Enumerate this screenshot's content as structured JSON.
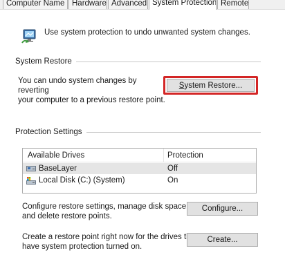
{
  "tabs": [
    "Computer Name",
    "Hardware",
    "Advanced",
    "System Protection",
    "Remote"
  ],
  "intro": {
    "icon": "system-protection-icon",
    "text": "Use system protection to undo unwanted system changes."
  },
  "system_restore": {
    "title": "System Restore",
    "description_line1": "You can undo system changes by reverting",
    "description_line2": "your computer to a previous restore point.",
    "button_u": "S",
    "button_rest": "ystem Restore...",
    "highlight_color": "#d32626"
  },
  "protection_settings": {
    "title": "Protection Settings",
    "columns": [
      "Available Drives",
      "Protection"
    ],
    "drives": [
      {
        "name": "BaseLayer",
        "protection": "Off",
        "icon": "drive-icon",
        "selected": true
      },
      {
        "name": "Local Disk (C:) (System)",
        "protection": "On",
        "icon": "system-drive-icon",
        "selected": false
      }
    ],
    "configure_text_line1": "Configure restore settings, manage disk space,",
    "configure_text_line2": "and delete restore points.",
    "configure_button_u": "O",
    "configure_button_rest": "Configure...",
    "create_text_line1": "Create a restore point right now for the drives that",
    "create_text_line2": "have system protection turned on.",
    "create_button_u": "C",
    "create_button_rest": "Create..."
  }
}
